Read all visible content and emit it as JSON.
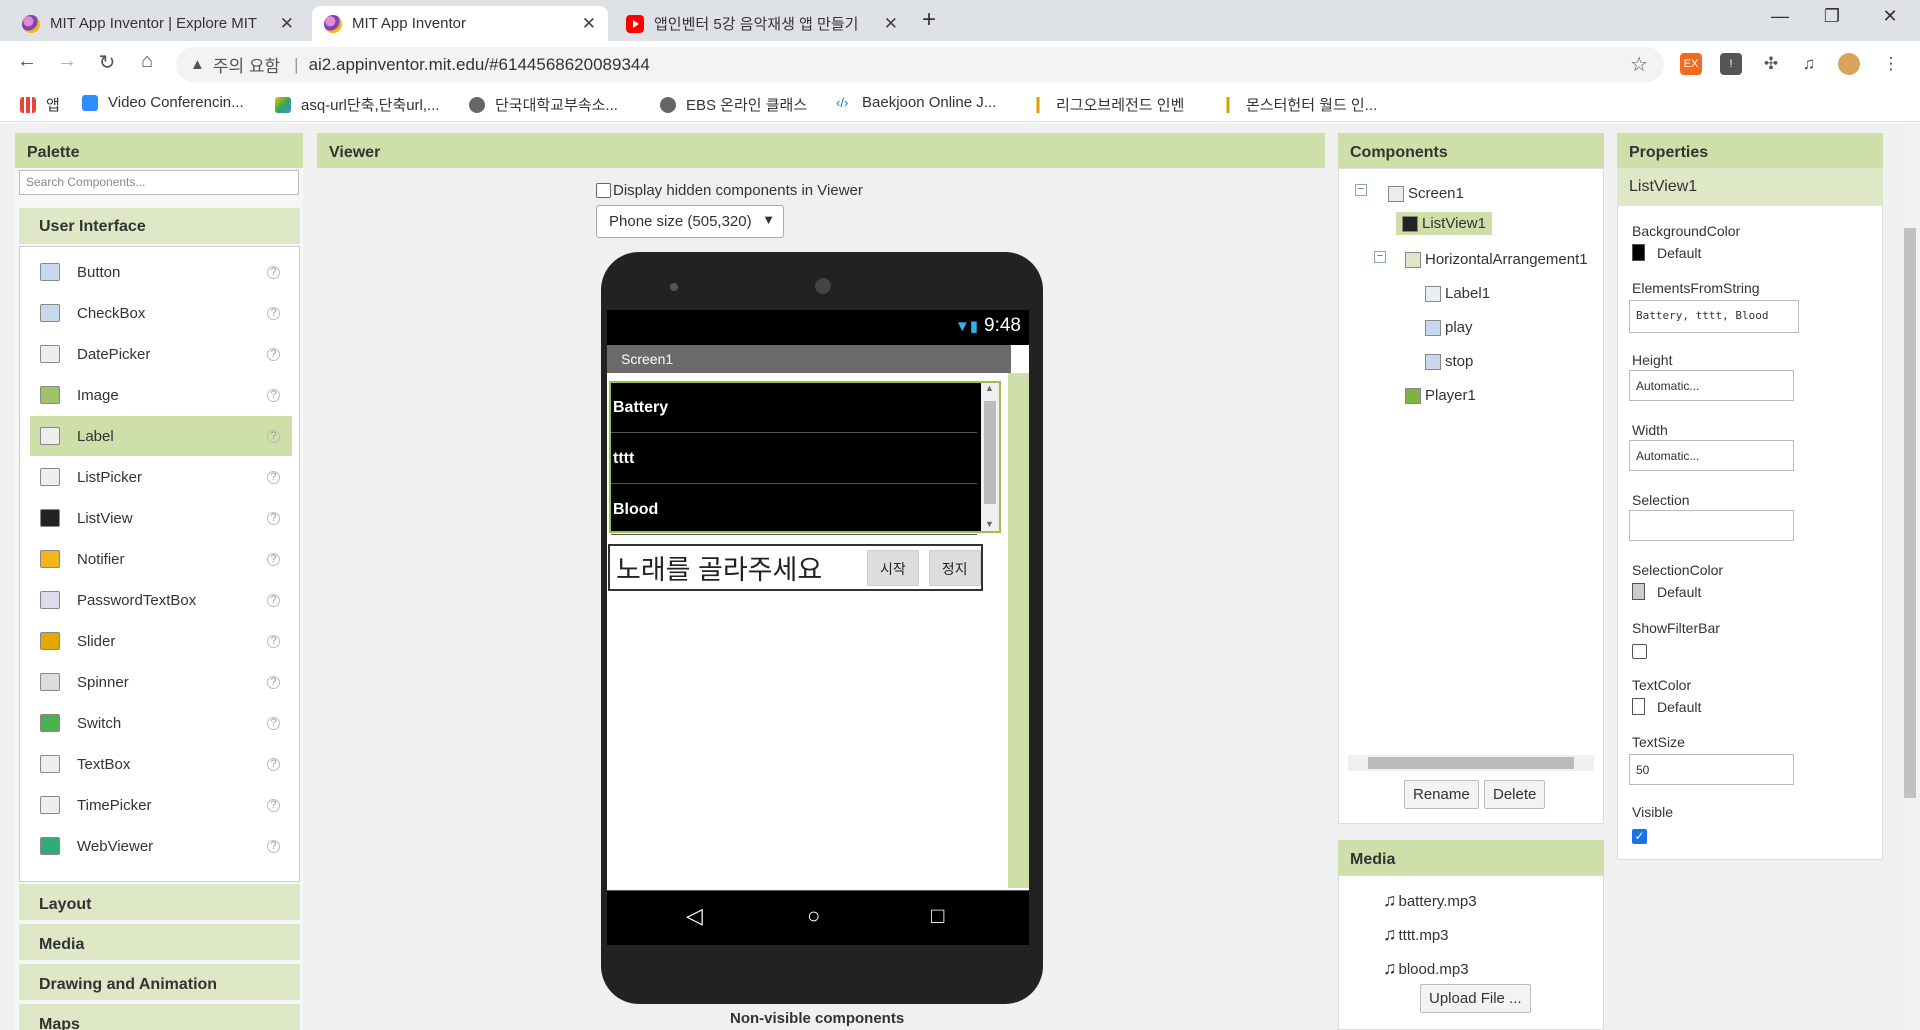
{
  "browser": {
    "tabs": [
      {
        "title": "MIT App Inventor | Explore MIT",
        "icon": "app-inventor-icon"
      },
      {
        "title": "MIT App Inventor",
        "icon": "app-inventor-icon"
      },
      {
        "title": "앱인벤터 5강 음악재생 앱 만들기",
        "icon": "youtube-icon"
      }
    ],
    "security_label": "주의 요함",
    "url": "ai2.appinventor.mit.edu/#6144568620089344",
    "bookmarks": [
      {
        "label": "앱"
      },
      {
        "label": "Video Conferencin..."
      },
      {
        "label": "asq-url단축,단축url,..."
      },
      {
        "label": "단국대학교부속소..."
      },
      {
        "label": "EBS 온라인 클래스"
      },
      {
        "label": "Baekjoon Online J..."
      },
      {
        "label": "리그오브레전드 인벤"
      },
      {
        "label": "몬스터헌터 월드 인..."
      }
    ]
  },
  "palette": {
    "title": "Palette",
    "search_placeholder": "Search Components...",
    "category_open": "User Interface",
    "items": [
      "Button",
      "CheckBox",
      "DatePicker",
      "Image",
      "Label",
      "ListPicker",
      "ListView",
      "Notifier",
      "PasswordTextBox",
      "Slider",
      "Spinner",
      "Switch",
      "TextBox",
      "TimePicker",
      "WebViewer"
    ],
    "selected_item": "Label",
    "help_glyph": "?",
    "other_categories": [
      "Layout",
      "Media",
      "Drawing and Animation",
      "Maps"
    ]
  },
  "viewer": {
    "title": "Viewer",
    "display_hidden_label": "Display hidden components in Viewer",
    "phone_size": "Phone size (505,320)",
    "status_time": "9:48",
    "screen_title": "Screen1",
    "list_items": [
      "Battery",
      "tttt",
      "Blood"
    ],
    "label_text": "노래를 골라주세요",
    "buttons": {
      "play": "시작",
      "stop": "정지"
    },
    "non_visible_label": "Non-visible components"
  },
  "components": {
    "title": "Components",
    "tree": [
      {
        "name": "Screen1",
        "depth": 0
      },
      {
        "name": "ListView1",
        "depth": 1
      },
      {
        "name": "HorizontalArrangement1",
        "depth": 1
      },
      {
        "name": "Label1",
        "depth": 2
      },
      {
        "name": "play",
        "depth": 2
      },
      {
        "name": "stop",
        "depth": 2
      },
      {
        "name": "Player1",
        "depth": 1
      }
    ],
    "rename_label": "Rename",
    "delete_label": "Delete"
  },
  "media": {
    "title": "Media",
    "files": [
      "battery.mp3",
      "tttt.mp3",
      "blood.mp3"
    ],
    "upload_label": "Upload File ..."
  },
  "properties": {
    "title": "Properties",
    "component": "ListView1",
    "background_color": {
      "label": "BackgroundColor",
      "value": "Default",
      "swatch": "#000000"
    },
    "elements_from_string": {
      "label": "ElementsFromString",
      "value": "Battery, tttt, Blood"
    },
    "height": {
      "label": "Height",
      "value": "Automatic..."
    },
    "width": {
      "label": "Width",
      "value": "Automatic..."
    },
    "selection": {
      "label": "Selection",
      "value": ""
    },
    "selection_color": {
      "label": "SelectionColor",
      "value": "Default",
      "swatch": "#cccccc"
    },
    "show_filter_bar": {
      "label": "ShowFilterBar",
      "checked": false
    },
    "text_color": {
      "label": "TextColor",
      "value": "Default",
      "swatch": "#ffffff"
    },
    "text_size": {
      "label": "TextSize",
      "value": "50"
    },
    "visible": {
      "label": "Visible",
      "checked": true
    }
  },
  "colors": {
    "panel_header": "#cfdfaa",
    "accent_check": "#1a73e8"
  }
}
